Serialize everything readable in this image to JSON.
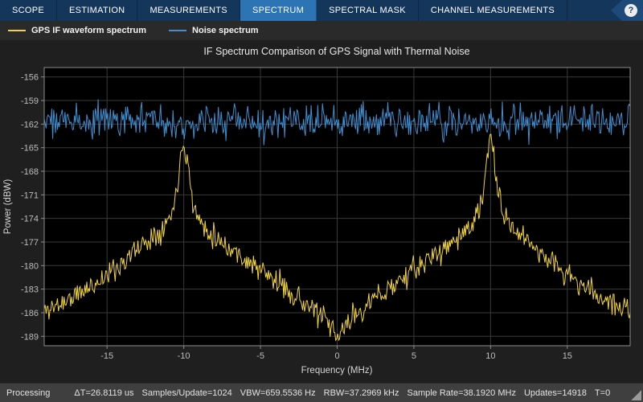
{
  "toolbar": {
    "tabs": [
      {
        "label": "SCOPE",
        "active": false
      },
      {
        "label": "ESTIMATION",
        "active": false
      },
      {
        "label": "MEASUREMENTS",
        "active": false
      },
      {
        "label": "SPECTRUM",
        "active": true
      },
      {
        "label": "SPECTRAL MASK",
        "active": false
      },
      {
        "label": "CHANNEL MEASUREMENTS",
        "active": false
      }
    ],
    "help_label": "?",
    "bar_color": "#15365b",
    "active_tab_color": "#2d74b4"
  },
  "legend": {
    "items": [
      {
        "label": "GPS IF waveform spectrum",
        "color": "#f0d33f"
      },
      {
        "label": "Noise spectrum",
        "color": "#3f8fd2"
      }
    ]
  },
  "chart_data": {
    "type": "line",
    "title": "IF Spectrum Comparison of GPS Signal with Thermal Noise",
    "xlabel": "Frequency (MHz)",
    "ylabel": "Power (dBW)",
    "xlim": [
      -19.096,
      19.096
    ],
    "ylim": [
      -190.2,
      -154.8
    ],
    "x_ticks": [
      -15,
      -10,
      -5,
      0,
      5,
      10,
      15
    ],
    "y_ticks": [
      -156,
      -159,
      -162,
      -165,
      -168,
      -171,
      -174,
      -177,
      -180,
      -183,
      -186,
      -189
    ],
    "grid": true,
    "legend_position": "top-bar",
    "plot_bg": "#000000",
    "grid_color": "#3a3a3a",
    "axis_color": "#8c8c8c",
    "tick_color": "#bdbdbd",
    "label_color": "#d6d6d6",
    "title_color": "#e8e8e8",
    "series": [
      {
        "id": "gps",
        "name": "GPS IF waveform spectrum",
        "color": "#f0d33f",
        "peak_frequencies_mhz": [
          -10,
          10
        ],
        "peak_level_dbw": -163,
        "null_frequency_mhz": 0,
        "null_level_dbw": -189,
        "edge_level_dbw": -186,
        "envelope_db": [
          [
            -19.096,
            -185.8
          ],
          [
            -18,
            -184.8
          ],
          [
            -17,
            -183.8
          ],
          [
            -16,
            -182.6
          ],
          [
            -15,
            -181.2
          ],
          [
            -14,
            -179.6
          ],
          [
            -13,
            -177.8
          ],
          [
            -12,
            -176.2
          ],
          [
            -11.2,
            -174.8
          ],
          [
            -10.7,
            -173
          ],
          [
            -10.45,
            -170
          ],
          [
            -10.2,
            -166
          ],
          [
            -10,
            -163.9
          ],
          [
            -9.8,
            -166
          ],
          [
            -9.55,
            -170
          ],
          [
            -9.3,
            -173
          ],
          [
            -8.8,
            -174.8
          ],
          [
            -8,
            -176.2
          ],
          [
            -7,
            -177.8
          ],
          [
            -6,
            -179.2
          ],
          [
            -5,
            -180.6
          ],
          [
            -4,
            -182
          ],
          [
            -3,
            -183.4
          ],
          [
            -2,
            -185
          ],
          [
            -1.2,
            -186.2
          ],
          [
            -0.6,
            -187.4
          ],
          [
            -0.25,
            -188.6
          ],
          [
            0,
            -189.4
          ],
          [
            0.25,
            -188.6
          ],
          [
            0.6,
            -187.4
          ],
          [
            1.2,
            -186.2
          ],
          [
            2,
            -185
          ],
          [
            3,
            -183.4
          ],
          [
            4,
            -182
          ],
          [
            5,
            -180.6
          ],
          [
            6,
            -179.2
          ],
          [
            7,
            -177.8
          ],
          [
            8,
            -176.2
          ],
          [
            8.8,
            -174.8
          ],
          [
            9.3,
            -173
          ],
          [
            9.55,
            -170
          ],
          [
            9.8,
            -166
          ],
          [
            10,
            -163.9
          ],
          [
            10.2,
            -166
          ],
          [
            10.45,
            -170
          ],
          [
            10.7,
            -173
          ],
          [
            11.2,
            -174.8
          ],
          [
            12,
            -176.2
          ],
          [
            13,
            -177.8
          ],
          [
            14,
            -179.6
          ],
          [
            15,
            -181.2
          ],
          [
            16,
            -182.6
          ],
          [
            17,
            -183.8
          ],
          [
            18,
            -184.8
          ],
          [
            19.096,
            -185.8
          ]
        ],
        "noise_db": 1.5,
        "points": 620,
        "seed": 11
      },
      {
        "id": "noise",
        "name": "Noise spectrum",
        "color": "#3f8fd2",
        "mean_level_dbw": -161.6,
        "envelope_db": [
          [
            -19.096,
            -161.6
          ],
          [
            19.096,
            -161.6
          ]
        ],
        "noise_db": 2.1,
        "points": 620,
        "seed": 97
      }
    ]
  },
  "status_bar": {
    "items": [
      "Processing",
      "ΔT=26.8119 us",
      "Samples/Update=1024",
      "VBW=659.5536 Hz",
      "RBW=37.2969 kHz",
      "Sample Rate=38.1920 MHz",
      "Updates=14918",
      "T=0"
    ]
  }
}
